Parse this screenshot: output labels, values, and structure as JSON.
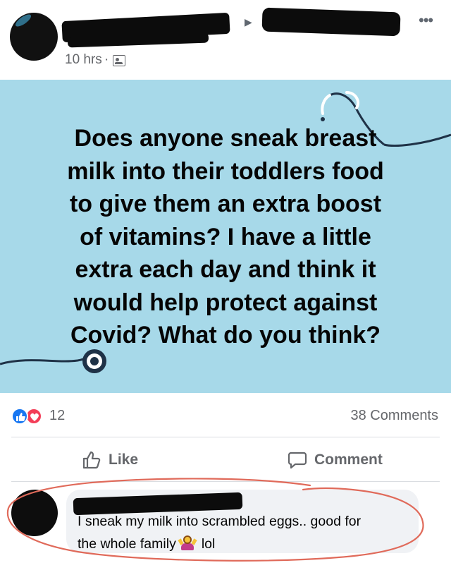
{
  "header": {
    "post_time": "10 hrs",
    "separator": "·",
    "audience_icon": "group-audience-icon",
    "more_icon": "more-options-icon",
    "more_label": "•••",
    "arrow_label": "▶"
  },
  "post": {
    "text_lines": [
      "Does anyone sneak breast",
      "milk into their toddlers food",
      "to give them an extra boost",
      "of vitamins? I have a little",
      "extra each day and think it",
      "would help protect against",
      "Covid? What do you think?"
    ],
    "background_color": "#a7d9e9"
  },
  "reactions": {
    "icons": [
      "like-reaction-icon",
      "love-reaction-icon"
    ],
    "count": "12",
    "comments_label": "38 Comments",
    "like_color": "#1877f2",
    "love_color": "#f33e58"
  },
  "actions": {
    "like_label": "Like",
    "comment_label": "Comment"
  },
  "comment": {
    "line_1": "I sneak my milk into scrambled eggs.. good for",
    "line_2_before_emoji": "the whole family",
    "emoji": "woman-shrugging-emoji",
    "line_2_after_emoji": "lol",
    "annotation_color": "#e06a5a"
  }
}
